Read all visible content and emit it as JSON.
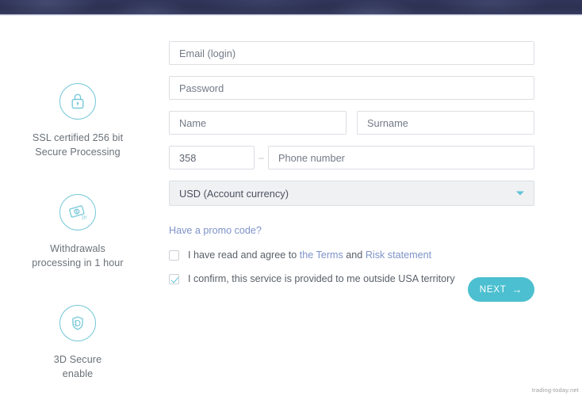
{
  "colors": {
    "hero_navy": "#2d3253",
    "teal": "#4cc0d0",
    "icon_teal": "#79c9d9",
    "link_blue": "#7e93c9",
    "text_gray": "#6b7178",
    "field_border": "#dcdee3",
    "select_fill": "#f0f1f3"
  },
  "features": [
    {
      "icon": "lock-icon",
      "line1": "SSL certified 256 bit",
      "line2": "Secure Processing"
    },
    {
      "icon": "banknote-1h-icon",
      "line1": "Withdrawals",
      "line2": "processing in 1 hour"
    },
    {
      "icon": "3d-secure-shield-icon",
      "line1": "3D Secure",
      "line2": "enable"
    }
  ],
  "form": {
    "email": {
      "value": "",
      "placeholder": "Email (login)"
    },
    "password": {
      "value": "",
      "placeholder": "Password"
    },
    "name": {
      "value": "",
      "placeholder": "Name"
    },
    "surname": {
      "value": "",
      "placeholder": "Surname"
    },
    "country_code": {
      "value": "358",
      "placeholder": "358"
    },
    "phone_separator": "–",
    "phone": {
      "value": "",
      "placeholder": "Phone number"
    },
    "currency": {
      "selected": "USD (Account currency)",
      "caret": "chevron-down-icon"
    },
    "promo_link": "Have a promo code?",
    "terms": {
      "checked": false,
      "prefix": "I have read and agree to ",
      "link1": "the Terms",
      "middle": " and ",
      "link2": "Risk statement"
    },
    "usa": {
      "checked": true,
      "text": "I confirm, this service is provided to me outside USA territory"
    },
    "next_button": {
      "label": "NEXT",
      "arrow": "→"
    }
  },
  "watermark": "trading-today.net"
}
